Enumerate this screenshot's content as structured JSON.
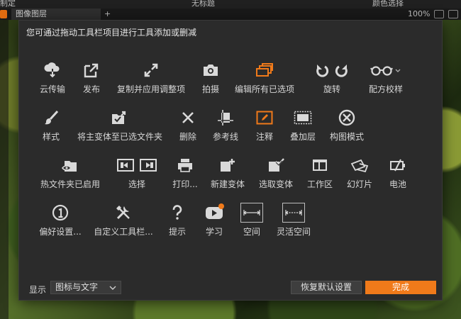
{
  "app": {
    "top_left": "制定",
    "top_center": "无标题",
    "top_right": "颜色选择",
    "tab_label": "图像图层",
    "tab_add": "+",
    "zoom": "100%"
  },
  "dialog": {
    "instruction": "您可通过拖动工具栏项目进行工具添加或删减",
    "rows": [
      [
        {
          "id": "cloud",
          "label": "云传输",
          "icon": "cloud-download-icon"
        },
        {
          "id": "publish",
          "label": "发布",
          "icon": "share-export-icon"
        },
        {
          "id": "copy-apply",
          "label": "复制并应用调整项",
          "icon": "expand-arrows-icon"
        },
        {
          "id": "capture",
          "label": "拍摄",
          "icon": "camera-icon"
        },
        {
          "id": "edit-all",
          "label": "编辑所有已选项",
          "icon": "stacked-layers-icon"
        },
        {
          "id": "rotate",
          "label": "旋转",
          "icon": "rotate-icon"
        },
        {
          "id": "recipe",
          "label": "配方校样",
          "icon": "glasses-icon"
        }
      ],
      [
        {
          "id": "style",
          "label": "样式",
          "icon": "brush-icon"
        },
        {
          "id": "move-variant",
          "label": "将主变体至已选文件夹",
          "icon": "move-to-folder-icon"
        },
        {
          "id": "delete",
          "label": "删除",
          "icon": "close-x-icon"
        },
        {
          "id": "guides",
          "label": "参考线",
          "icon": "guides-icon"
        },
        {
          "id": "annotate",
          "label": "注释",
          "icon": "annotate-pencil-icon"
        },
        {
          "id": "overlay",
          "label": "叠加层",
          "icon": "overlay-icon"
        },
        {
          "id": "composition",
          "label": "构图模式",
          "icon": "circle-x-icon"
        }
      ],
      [
        {
          "id": "hotfolder",
          "label": "热文件夹已启用",
          "icon": "hot-folder-eye-icon"
        },
        {
          "id": "select",
          "label": "选择",
          "icon": "select-prev-next-icon"
        },
        {
          "id": "print",
          "label": "打印...",
          "icon": "printer-icon"
        },
        {
          "id": "new-variant",
          "label": "新建变体",
          "icon": "new-variant-icon"
        },
        {
          "id": "pick-variant",
          "label": "选取变体",
          "icon": "pick-variant-icon"
        },
        {
          "id": "workspace",
          "label": "工作区",
          "icon": "workspace-icon"
        },
        {
          "id": "slideshow",
          "label": "幻灯片",
          "icon": "slides-icon"
        },
        {
          "id": "battery",
          "label": "电池",
          "icon": "battery-icon"
        }
      ],
      [
        {
          "id": "prefs",
          "label": "偏好设置...",
          "icon": "info-circle-icon"
        },
        {
          "id": "customize",
          "label": "自定义工具栏...",
          "icon": "tools-icon"
        },
        {
          "id": "tips",
          "label": "提示",
          "icon": "question-mark-icon"
        },
        {
          "id": "learn",
          "label": "学习",
          "icon": "video-play-icon"
        },
        {
          "id": "space",
          "label": "空间",
          "icon": "fixed-space-icon"
        },
        {
          "id": "flex-space",
          "label": "灵活空间",
          "icon": "flexible-space-icon"
        }
      ]
    ],
    "footer": {
      "show_label": "显示",
      "show_value": "图标与文字",
      "reset_label": "恢复默认设置",
      "done_label": "完成"
    }
  },
  "colors": {
    "accent": "#f07a1a",
    "icon": "#d9d9d9",
    "dialog_bg": "#2b2b2b"
  }
}
